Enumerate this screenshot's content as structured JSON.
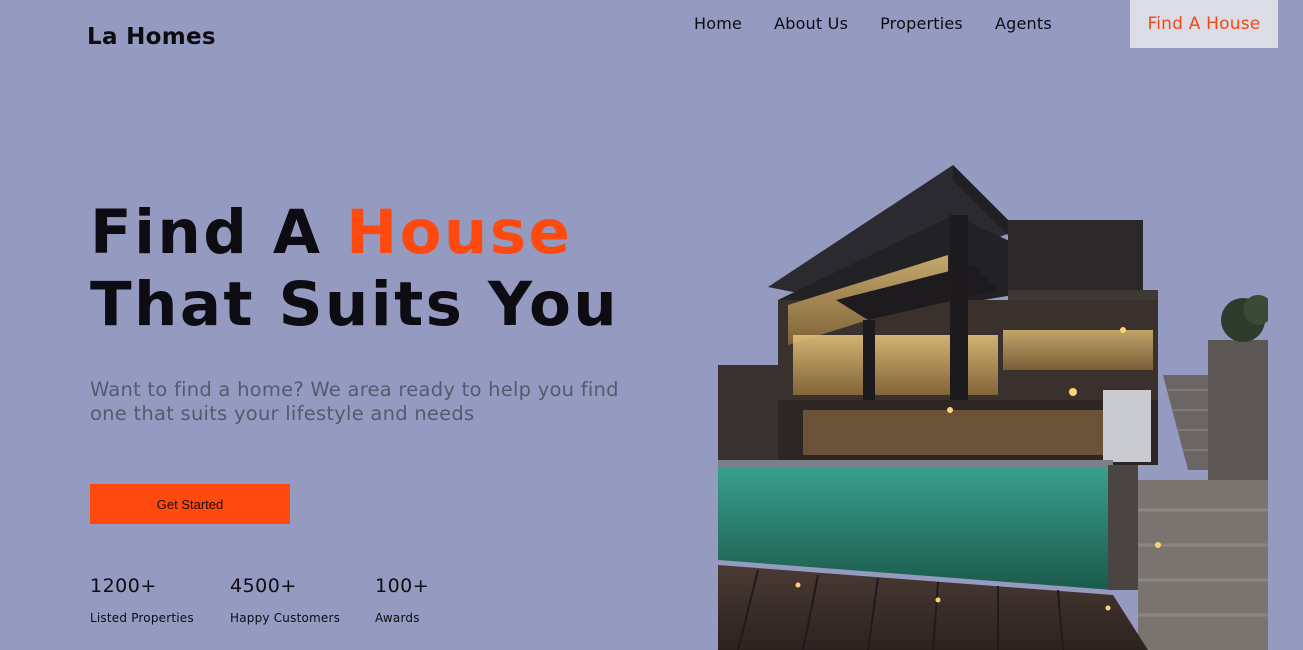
{
  "brand": {
    "name": "La Homes"
  },
  "nav": {
    "items": [
      {
        "label": "Home"
      },
      {
        "label": "About Us"
      },
      {
        "label": "Properties"
      },
      {
        "label": "Agents"
      }
    ],
    "cta_label": "Find A House"
  },
  "hero": {
    "title_part1": "Find A ",
    "title_accent": "House",
    "title_line2": "That Suits You",
    "subtitle": "Want to find a home? We area ready to help you find one that suits your lifestyle and needs",
    "button_label": "Get Started"
  },
  "stats": [
    {
      "value": "1200+",
      "label": "Listed Properties"
    },
    {
      "value": "4500+",
      "label": "Happy Customers"
    },
    {
      "value": "100+",
      "label": "Awards"
    }
  ],
  "colors": {
    "background": "#959ac0",
    "accent": "#ff4a0f",
    "nav_cta_bg": "#dcdce6"
  }
}
